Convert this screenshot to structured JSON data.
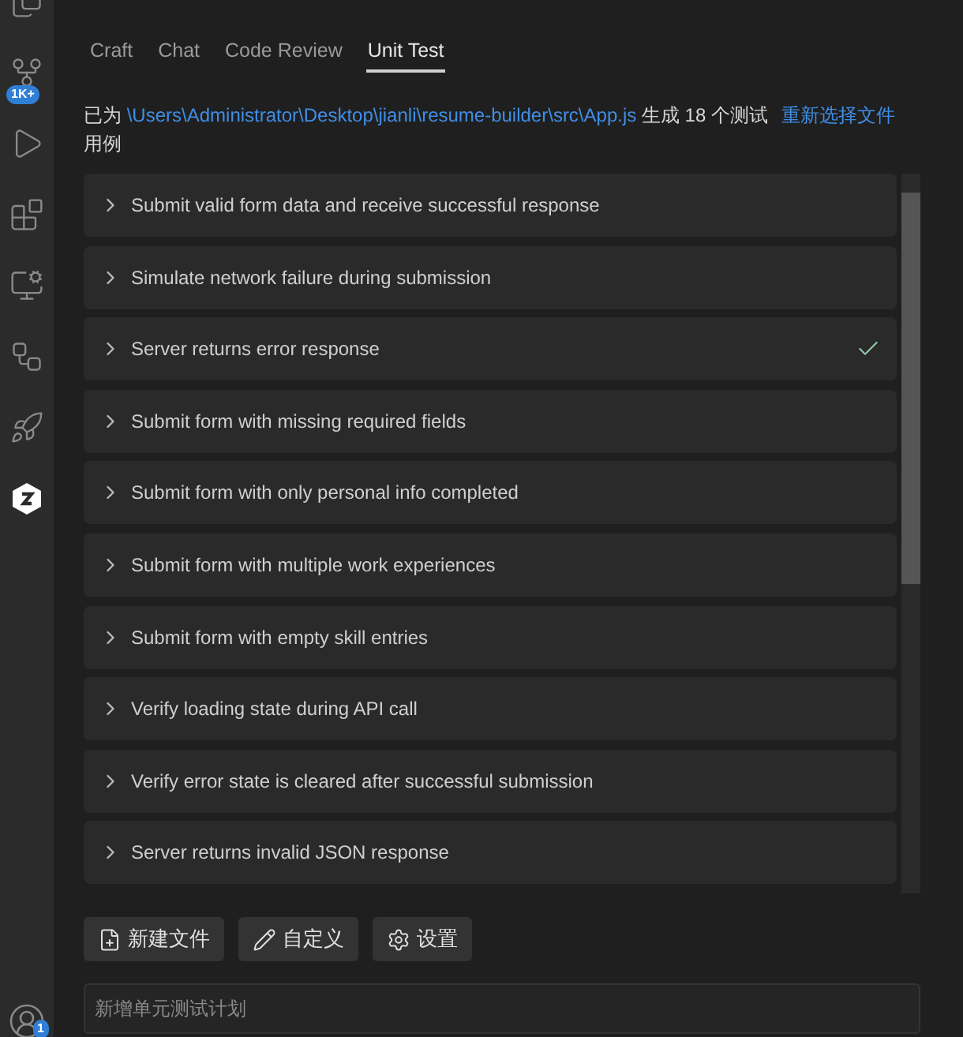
{
  "activity_bar": {
    "items": [
      {
        "kind": "files",
        "selected": false
      },
      {
        "kind": "source-control",
        "selected": false,
        "badge": "1K+"
      },
      {
        "kind": "run",
        "selected": false
      },
      {
        "kind": "extensions",
        "selected": false
      },
      {
        "kind": "remote",
        "selected": false
      },
      {
        "kind": "network",
        "selected": false
      },
      {
        "kind": "rocket",
        "selected": false
      },
      {
        "kind": "logo",
        "selected": true
      }
    ],
    "account_badge": "1"
  },
  "tabs": [
    {
      "label": "Craft",
      "selected": false
    },
    {
      "label": "Chat",
      "selected": false
    },
    {
      "label": "Code Review",
      "selected": false
    },
    {
      "label": "Unit Test",
      "selected": true
    }
  ],
  "info": {
    "prefix": "已为",
    "path": "\\Users\\Administrator\\Desktop\\jianli\\resume-builder\\src\\App.js",
    "suffix": "生成 18 个测试用例",
    "reselect": "重新选择文件"
  },
  "tests": [
    {
      "title": "Submit valid form data and receive successful response",
      "passed": false
    },
    {
      "title": "Simulate network failure during submission",
      "passed": false
    },
    {
      "title": "Server returns error response",
      "passed": true
    },
    {
      "title": "Submit form with missing required fields",
      "passed": false
    },
    {
      "title": "Submit form with only personal info completed",
      "passed": false
    },
    {
      "title": "Submit form with multiple work experiences",
      "passed": false
    },
    {
      "title": "Submit form with empty skill entries",
      "passed": false
    },
    {
      "title": "Verify loading state during API call",
      "passed": false
    },
    {
      "title": "Verify error state is cleared after successful submission",
      "passed": false
    },
    {
      "title": "Server returns invalid JSON response",
      "passed": false
    }
  ],
  "buttons": [
    {
      "kind": "new-file",
      "label": "新建文件"
    },
    {
      "kind": "edit",
      "label": "自定义"
    },
    {
      "kind": "settings",
      "label": "设置"
    }
  ],
  "input": {
    "placeholder": "新增单元测试计划"
  }
}
